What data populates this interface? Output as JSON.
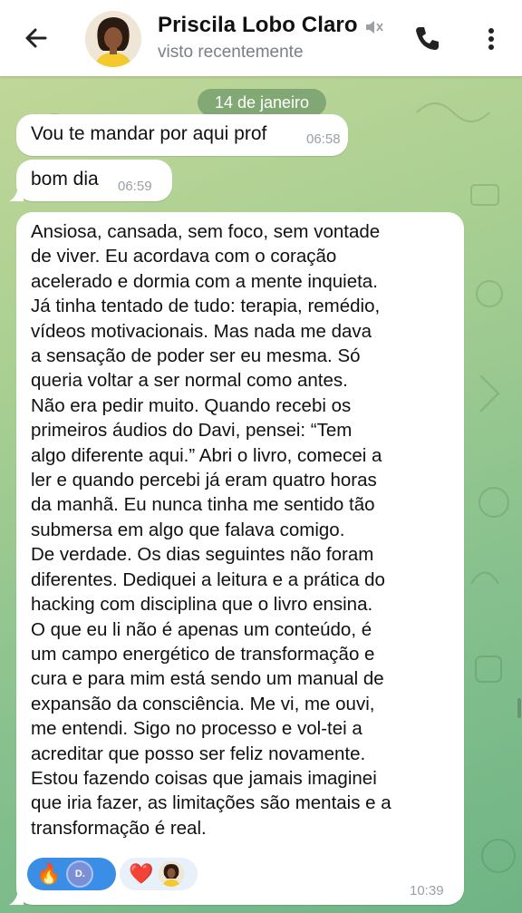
{
  "header": {
    "contact_name": "Priscila Lobo Claro",
    "status": "visto recentemente",
    "icons": {
      "back": "arrow-back-icon",
      "mute": "speaker-muted-icon",
      "call": "phone-icon",
      "menu": "more-vertical-icon"
    }
  },
  "chat": {
    "date_chip": "14 de janeiro",
    "messages": [
      {
        "text": "Vou te mandar por aqui prof",
        "time": "06:58"
      },
      {
        "text": "bom dia",
        "time": "06:59"
      },
      {
        "lines": [
          "Ansiosa, cansada, sem foco, sem vontade",
          "de viver. Eu acordava com o coração",
          "acelerado e dormia com a mente inquieta.",
          "Já tinha tentado de tudo: terapia, remédio,",
          "vídeos motivacionais. Mas nada me dava",
          "a sensação de poder ser eu mesma. Só",
          "queria voltar a ser normal como antes.",
          "Não era pedir muito. Quando recebi os",
          "primeiros áudios do Davi, pensei: “Tem",
          "algo diferente aqui.” Abri o livro, comecei a",
          "ler e quando percebi já eram quatro horas",
          "da manhã. Eu nunca tinha me sentido tão",
          "submersa em algo que falava comigo.",
          "De verdade. Os dias seguintes não foram",
          "diferentes. Dediquei a leitura e a prática do",
          "hacking com disciplina que o livro ensina.",
          "O que eu li não é apenas um conteúdo, é",
          "um campo energético de transformação e",
          "cura e para mim está sendo um manual de",
          "expansão da consciência. Me vi, me ouvi,",
          "me entendi. Sigo no processo e vol-tei a",
          "acreditar que posso ser feliz novamente.",
          "Estou fazendo coisas que jamais imaginei",
          "que iria fazer, as limitações são mentais e a",
          "transformação é real."
        ],
        "time": "10:39",
        "reactions": [
          {
            "emoji": "🔥",
            "avatar_initial": "D."
          },
          {
            "emoji": "❤️"
          }
        ]
      }
    ]
  },
  "colors": {
    "header_bg": "#ffffff",
    "bubble_bg": "#ffffff",
    "reaction_selected": "#3a8ee6",
    "date_chip_bg": "#78a06e",
    "time_text": "#9aa0a6"
  }
}
